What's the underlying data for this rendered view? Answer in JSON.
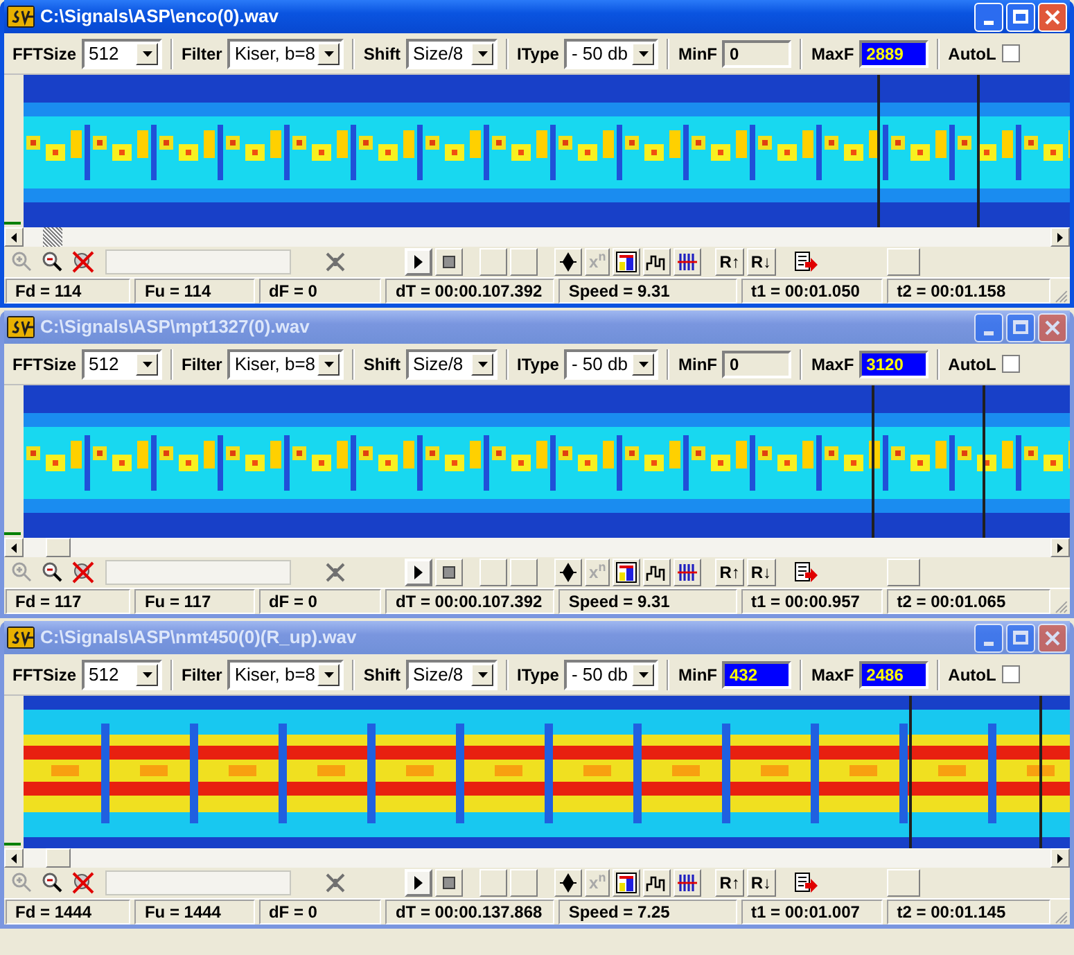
{
  "windows": [
    {
      "title": "C:\\Signals\\ASP\\enco(0).wav",
      "active": true,
      "spectrum": {
        "kind": "bursts",
        "cursors": [
          {
            "level": 0.815
          },
          {
            "level": 0.91
          }
        ]
      },
      "toolbar": {
        "fft_label": "FFTSize",
        "fft_size": "512",
        "filter_label": "Filter",
        "filter": "Kiser, b=8",
        "shift_label": "Shift",
        "shift": "Size/8",
        "itype_label": "IType",
        "itype": "- 50 db",
        "minf_label": "MinF",
        "minf": {
          "value": "0",
          "highlighted": false
        },
        "maxf_label": "MaxF",
        "maxf": {
          "value": "2889",
          "highlighted": true
        },
        "autol_label": "AutoL",
        "autol": {
          "checked": false
        }
      },
      "tools": [
        {
          "label": "x$^{n}$",
          "disabled": true
        },
        {
          "label": "R↑",
          "disabled": false
        },
        {
          "label": "R↓",
          "disabled": false
        }
      ],
      "play": {
        "selected": true
      },
      "status": [
        "Fd = 114",
        "Fu = 114",
        "dF = 0",
        "dT = 00:00.107.392",
        "Speed = 9.31",
        "t1 = 00:01.050",
        "t2 = 00:01.158"
      ]
    },
    {
      "title": "C:\\Signals\\ASP\\mpt1327(0).wav",
      "active": false,
      "spectrum": {
        "kind": "bursts",
        "cursors": [
          {
            "level": 0.81
          },
          {
            "level": 0.915
          }
        ]
      },
      "toolbar": {
        "fft_label": "FFTSize",
        "fft_size": "512",
        "filter_label": "Filter",
        "filter": "Kiser, b=8",
        "shift_label": "Shift",
        "shift": "Size/8",
        "itype_label": "IType",
        "itype": "- 50 db",
        "minf_label": "MinF",
        "minf": {
          "value": "0",
          "highlighted": false
        },
        "maxf_label": "MaxF",
        "maxf": {
          "value": "3120",
          "highlighted": true
        },
        "autol_label": "AutoL",
        "autol": {
          "checked": false
        }
      },
      "tools": [
        {
          "label": "x$^{n}$",
          "disabled": true
        },
        {
          "label": "R↑",
          "disabled": false
        },
        {
          "label": "R↓",
          "disabled": false
        }
      ],
      "play": {
        "selected": true
      },
      "status": [
        "Fd = 117",
        "Fu = 117",
        "dF = 0",
        "dT = 00:00.107.392",
        "Speed = 9.31",
        "t1 = 00:00.957",
        "t2 = 00:01.065"
      ]
    },
    {
      "title": "C:\\Signals\\ASP\\nmt450(0)(R_up).wav",
      "active": false,
      "spectrum": {
        "kind": "bands",
        "cursors": [
          {
            "level": 0.845
          },
          {
            "level": 0.97
          }
        ]
      },
      "toolbar": {
        "fft_label": "FFTSize",
        "fft_size": "512",
        "filter_label": "Filter",
        "filter": "Kiser, b=8",
        "shift_label": "Shift",
        "shift": "Size/8",
        "itype_label": "IType",
        "itype": "- 50 db",
        "minf_label": "MinF",
        "minf": {
          "value": "432",
          "highlighted": true
        },
        "maxf_label": "MaxF",
        "maxf": {
          "value": "2486",
          "highlighted": true
        },
        "autol_label": "AutoL",
        "autol": {
          "checked": false
        }
      },
      "tools": [
        {
          "label": "x$^{n}$",
          "disabled": true
        },
        {
          "label": "R↑",
          "disabled": false
        },
        {
          "label": "R↓",
          "disabled": false
        }
      ],
      "play": {
        "selected": true
      },
      "status": [
        "Fd = 1444",
        "Fu = 1444",
        "dF = 0",
        "dT = 00:00.137.868",
        "Speed = 7.25",
        "t1 = 00:01.007",
        "t2 = 00:01.145"
      ]
    }
  ]
}
